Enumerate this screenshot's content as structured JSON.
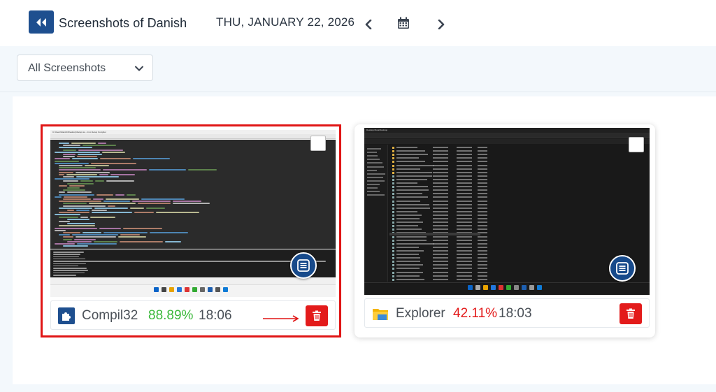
{
  "header": {
    "title": "Screenshots of Danish",
    "date": "THU, JANUARY 22, 2026",
    "icons": {
      "back": "double-chevron-left-icon",
      "prev": "chevron-left-icon",
      "calendar": "calendar-icon",
      "next": "chevron-right-icon"
    }
  },
  "filter": {
    "selected": "All Screenshots",
    "icon": "chevron-down-icon"
  },
  "cards": [
    {
      "app": "Compil32",
      "percent": "88.89%",
      "time": "18:06",
      "percent_color": "#3cb93c",
      "selected": true,
      "app_icon": "puzzle-icon",
      "thumbnail_title": "C:\\Users\\Danish\\Desktop\\Setup.iss - Inno Setup Compiler"
    },
    {
      "app": "Explorer",
      "percent": "42.11%",
      "time": "18:03",
      "percent_color": "#e31b1b",
      "selected": false,
      "app_icon": "folder-icon",
      "thumbnail_title": "Desktop\\Dora\\Desktop"
    }
  ],
  "colors": {
    "accent": "#1e4f8f",
    "selection": "#e01515",
    "delete": "#e31b1b"
  }
}
